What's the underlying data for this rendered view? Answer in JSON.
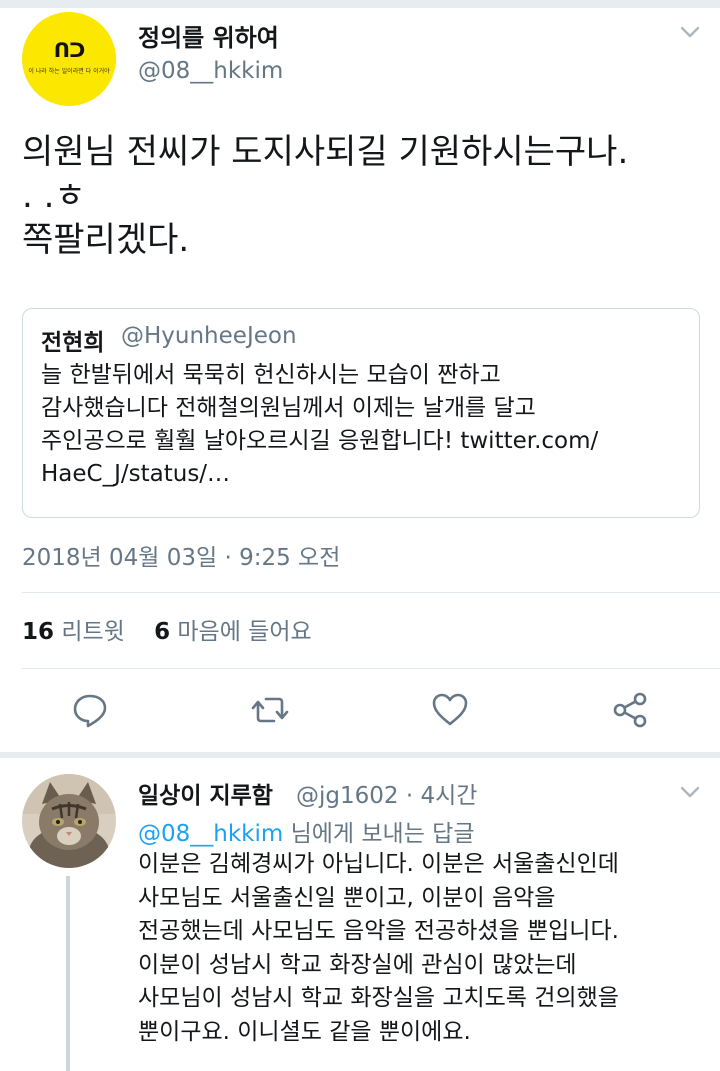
{
  "tweet": {
    "author_name": "정의를 위하여",
    "author_handle": "@08__hkkim",
    "avatar_logo": "ᑎᑐ",
    "avatar_subtext": "이 나라 하는 일이라면 다 이거야",
    "text": "의원님 전씨가 도지사되길 기원하시는구나.\n. .ㅎ\n쪽팔리겠다.",
    "quoted": {
      "author_name": "전현희",
      "author_handle": "@HyunheeJeon",
      "text": "늘 한발뒤에서 묵묵히 헌신하시는 모습이 짠하고\n감사했습니다 전해철의원님께서 이제는 날개를 달고\n주인공으로 훨훨 날아오르시길 응원합니다! twitter.com/\nHaeC_J/status/…"
    },
    "timestamp": "2018년 04월 03일 · 9:25 오전",
    "retweet_count": "16",
    "retweet_label": "리트윗",
    "like_count": "6",
    "like_label": "마음에 들어요",
    "actions": [
      "reply-icon",
      "retweet-icon",
      "like-icon",
      "share-icon"
    ]
  },
  "reply": {
    "author_name": "일상이 지루함",
    "meta": "@jg1602 · 4시간",
    "replying_mention": "@08__hkkim",
    "replying_suffix": " 님에게 보내는 답글",
    "text": "이분은 김혜경씨가 아닙니다. 이분은 서울출신인데\n사모님도 서울출신일 뿐이고, 이분이 음악을\n전공했는데 사모님도 음악을 전공하셨을 뿐입니다.\n이분이 성남시 학교 화장실에 관심이 많았는데\n사모님이 성남시 학교 화장실을 고치도록 건의했을\n뿐이구요. 이니셜도 같을 뿐이에요."
  },
  "colors": {
    "accent": "#1da1f2",
    "secondary_text": "#657786",
    "avatar_yellow": "#fbe700"
  }
}
